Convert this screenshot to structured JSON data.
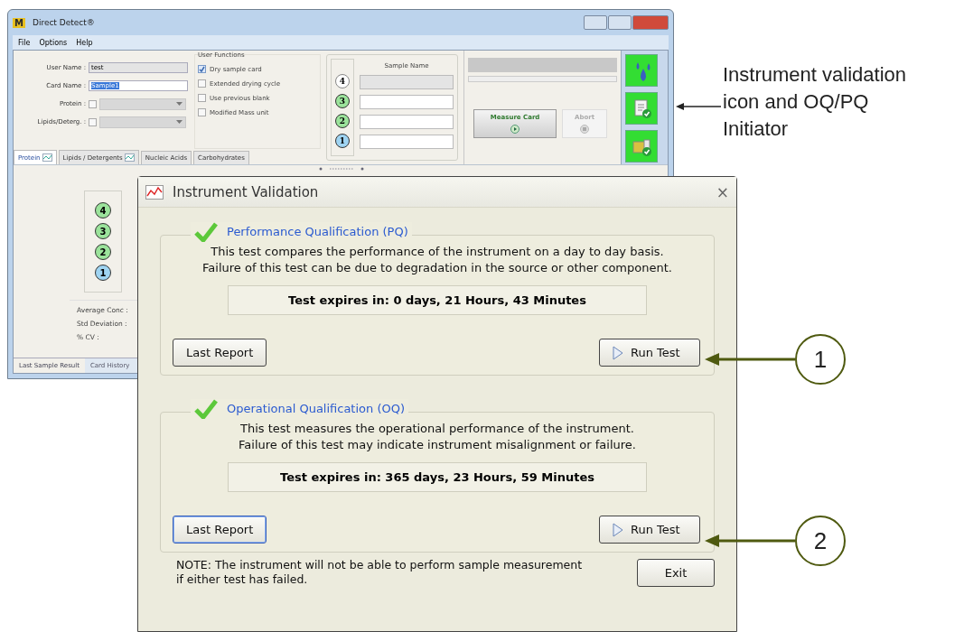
{
  "app": {
    "title": "Direct Detect®",
    "logo": "M",
    "menu": [
      "File",
      "Options",
      "Help"
    ],
    "fields": [
      {
        "label": "User Name :",
        "value": "test",
        "kind": "readonly"
      },
      {
        "label": "Card Name :",
        "value": "Sample1",
        "kind": "selected"
      }
    ],
    "combos": [
      {
        "label": "Protein :",
        "checked": false
      },
      {
        "label": "Lipids/Deterg. :",
        "checked": false
      }
    ],
    "user_functions": {
      "title": "User Functions",
      "options": [
        {
          "label": "Dry sample card",
          "checked": true
        },
        {
          "label": "Extended drying cycle",
          "checked": false
        },
        {
          "label": "Use previous blank",
          "checked": false
        },
        {
          "label": "Modified Mass unit",
          "checked": false
        }
      ]
    },
    "sample_panel": {
      "title": "Sample Name",
      "positions": [
        {
          "number": "4",
          "color": "#ffffff",
          "enabled": false
        },
        {
          "number": "3",
          "color": "#9be39b",
          "enabled": true
        },
        {
          "number": "2",
          "color": "#9be39b",
          "enabled": true
        },
        {
          "number": "1",
          "color": "#9fd4f2",
          "enabled": true
        }
      ]
    },
    "actions": [
      {
        "label": "Measure Card",
        "disabled": false
      },
      {
        "label": "Abort",
        "disabled": true
      }
    ],
    "tabs": [
      {
        "label": "Protein",
        "selected": true,
        "chart_icon": true
      },
      {
        "label": "Lipids / Detergents",
        "selected": false,
        "chart_icon": true
      },
      {
        "label": "Nucleic Acids",
        "selected": false,
        "chart_icon": false
      },
      {
        "label": "Carbohydrates",
        "selected": false,
        "chart_icon": false
      }
    ],
    "result_positions": [
      {
        "number": "4",
        "color": "#9be39b"
      },
      {
        "number": "3",
        "color": "#9be39b"
      },
      {
        "number": "2",
        "color": "#9be39b"
      },
      {
        "number": "1",
        "color": "#9fd4f2"
      }
    ],
    "stats": [
      "Average Conc :",
      "Std Deviation :",
      "% CV :"
    ],
    "bottom_tabs": [
      {
        "label": "Last Sample Result",
        "selected": true
      },
      {
        "label": "Card History",
        "selected": false
      }
    ]
  },
  "dialog": {
    "title": "Instrument Validation",
    "close": "×",
    "sections": [
      {
        "title": "Performance Qualification  (PQ)",
        "passed": true,
        "lines": [
          "This test compares the performance of the instrument on a day to day basis.",
          "Failure of this test can be due to degradation in the source or other component."
        ],
        "expiry": "Test expires in: 0 days, 21 Hours, 43 Minutes",
        "report_button": "Last Report",
        "report_focused": false,
        "run_button": "Run Test"
      },
      {
        "title": "Operational Qualification  (OQ)",
        "passed": true,
        "lines": [
          "This test measures the operational performance of the instrument.",
          "Failure of this test may indicate instrument misalignment or failure."
        ],
        "expiry": "Test expires in: 365 days, 23 Hours, 59 Minutes",
        "report_button": "Last Report",
        "report_focused": true,
        "run_button": "Run Test"
      }
    ],
    "note": [
      "NOTE:  The instrument will not be able to perform sample measurement",
      "if either test has failed."
    ],
    "exit_button": "Exit"
  },
  "annotation": {
    "lines": [
      "Instrument validation",
      "icon and OQ/PQ",
      "Initiator"
    ]
  },
  "callouts": [
    "1",
    "2"
  ]
}
